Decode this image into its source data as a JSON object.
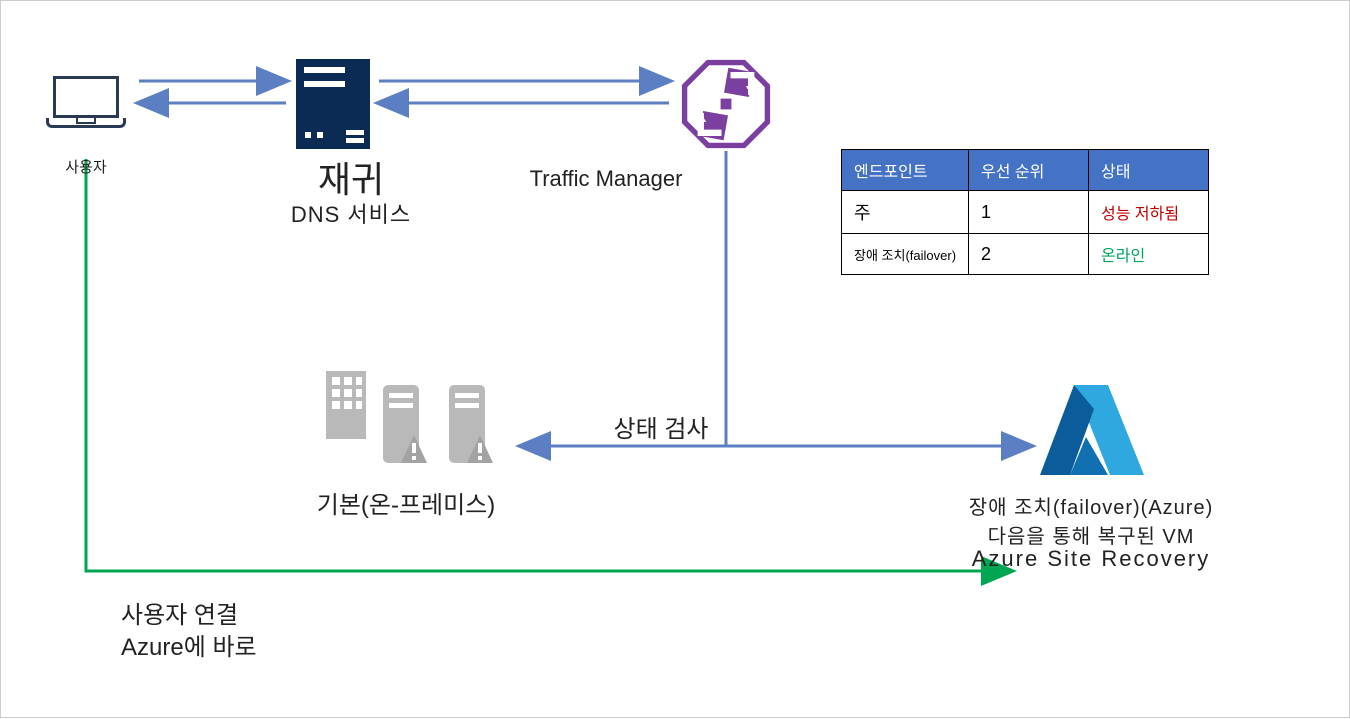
{
  "labels": {
    "user": "사용자",
    "dns_title": "재귀",
    "dns_sub": "DNS 서비스",
    "traffic_manager": "Traffic Manager",
    "health_check": "상태 검사",
    "onprem": "기본(온-프레미스)",
    "azure_l1": "장애 조치(failover)(Azure)",
    "azure_l2": "다음을 통해 복구된 VM",
    "azure_l3": "Azure Site Recovery",
    "user_conn_1": "사용자 연결",
    "user_conn_2": "Azure에 바로"
  },
  "table": {
    "headers": {
      "endpoint": "엔드포인트",
      "priority": "우선 순위",
      "status": "상태"
    },
    "rows": [
      {
        "endpoint": "주",
        "priority": "1",
        "status": "성능 저하됨",
        "status_class": "degraded"
      },
      {
        "endpoint": "장애 조치(failover)",
        "priority": "2",
        "status": "온라인",
        "status_class": "online"
      }
    ]
  },
  "colors": {
    "blue": "#5b7fc2",
    "green": "#00a651",
    "dark_blue": "#0b2b55",
    "purple": "#6b2a84",
    "azure": "#1e90ff",
    "azure_dark": "#0a5d9a"
  }
}
